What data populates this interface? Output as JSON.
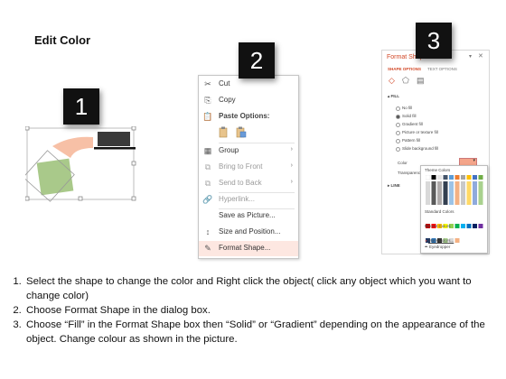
{
  "title": "Edit Color",
  "badges": {
    "one": "1",
    "two": "2",
    "three": "3"
  },
  "context_menu": {
    "items": [
      {
        "icon": "cut-icon",
        "glyph": "✂",
        "label": "Cut",
        "state": "normal",
        "arrow": ""
      },
      {
        "icon": "copy-icon",
        "glyph": "⎘",
        "label": "Copy",
        "state": "normal",
        "arrow": ""
      },
      {
        "icon": "paste-icon",
        "glyph": "📋",
        "label": "Paste Options:",
        "state": "normal",
        "arrow": ""
      },
      {
        "icon": "group-icon",
        "glyph": "▦",
        "label": "Group",
        "state": "normal",
        "arrow": "›"
      },
      {
        "icon": "bring-to-front-icon",
        "glyph": "⧉",
        "label": "Bring to Front",
        "state": "dim",
        "arrow": "›"
      },
      {
        "icon": "send-to-back-icon",
        "glyph": "⧉",
        "label": "Send to Back",
        "state": "dim",
        "arrow": "›"
      },
      {
        "icon": "hyperlink-icon",
        "glyph": "🔗",
        "label": "Hyperlink...",
        "state": "dim",
        "arrow": ""
      },
      {
        "icon": "save-as-picture-icon",
        "glyph": "",
        "label": "Save as Picture...",
        "state": "normal",
        "arrow": ""
      },
      {
        "icon": "size-position-icon",
        "glyph": "↕",
        "label": "Size and Position...",
        "state": "normal",
        "arrow": ""
      },
      {
        "icon": "format-shape-icon",
        "glyph": "✎",
        "label": "Format Shape...",
        "state": "highlight",
        "arrow": ""
      }
    ]
  },
  "format_pane": {
    "title": "Format Shape",
    "tabs": [
      "SHAPE OPTIONS",
      "TEXT OPTIONS"
    ],
    "fill_header": "FILL",
    "fill_options": [
      "No fill",
      "Solid fill",
      "Gradient fill",
      "Picture or texture fill",
      "Pattern fill",
      "Slide background fill"
    ],
    "color_label": "Color",
    "transparency_label": "Transparency",
    "line_header": "LINE",
    "palette": {
      "theme_colors_label": "Theme Colors",
      "standard_colors_label": "Standard Colors",
      "recent_colors_label": "Recent Colors",
      "more_colors": "More Colors...",
      "eyedropper": "Eyedropper"
    }
  },
  "instructions": [
    "Select the shape to change the color and Right click the object( click any object which you want to change color)",
    "Choose Format Shape in the dialog box.",
    "Choose “Fill” in the Format Shape box then “Solid” or “Gradient” depending on the appearance of the object. Change colour as shown in the picture."
  ]
}
